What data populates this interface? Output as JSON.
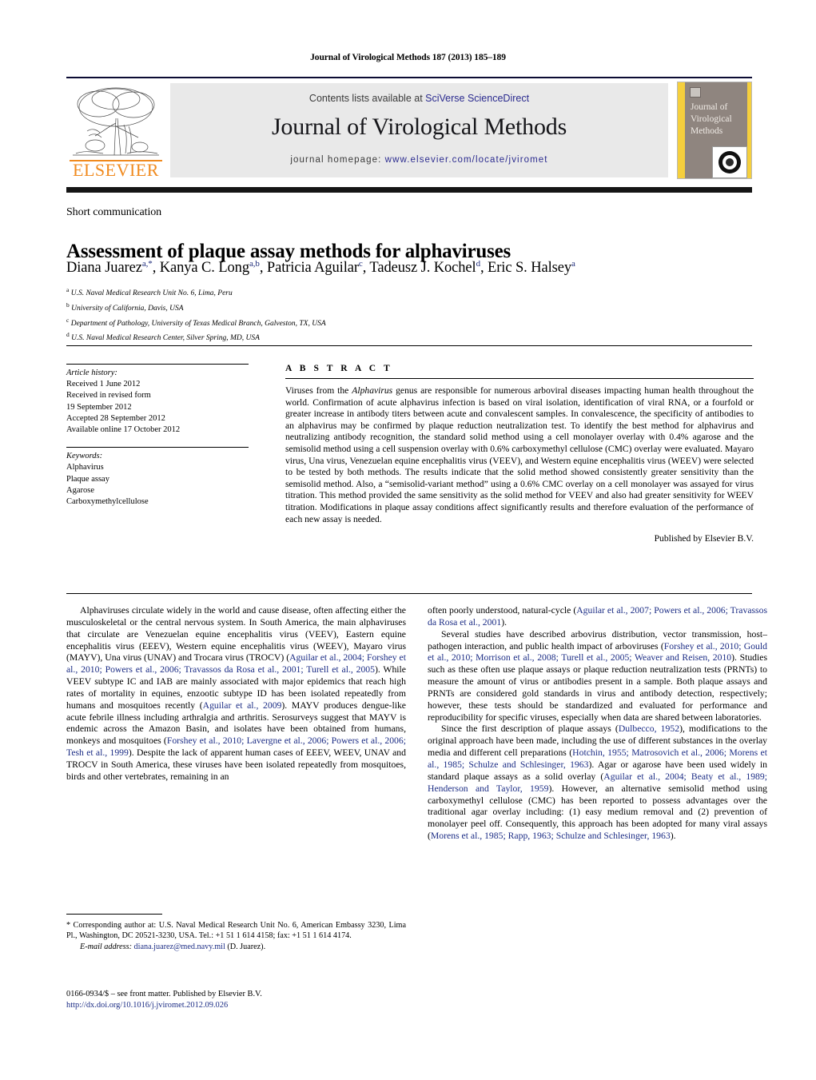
{
  "running_head": "Journal of Virological Methods 187 (2013) 185–189",
  "masthead": {
    "contents_prefix": "Contents lists available at ",
    "contents_link": "SciVerse ScienceDirect",
    "journal_title": "Journal of Virological Methods",
    "homepage_prefix": "journal homepage: ",
    "homepage_url": "www.elsevier.com/locate/jviromet",
    "publisher_logo_text": "ELSEVIER",
    "cover_title": "Journal of Virological Methods",
    "link_color": "#2b2b8f",
    "band_color": "#e9e9e9",
    "cover_accent": "#f5cf3d",
    "logo_color": "#f08a1e"
  },
  "article": {
    "section_type": "Short communication",
    "title": "Assessment of plaque assay methods for alphaviruses",
    "authors_html": "Diana Juarez<sup>a,*</sup>, Kanya C. Long<sup>a,b</sup>, Patricia Aguilar<sup>c</sup>, Tadeusz J. Kochel<sup>d</sup>, Eric S. Halsey<sup>a</sup>",
    "affiliations": [
      {
        "marker": "a",
        "text": "U.S. Naval Medical Research Unit No. 6, Lima, Peru"
      },
      {
        "marker": "b",
        "text": "University of California, Davis, USA"
      },
      {
        "marker": "c",
        "text": "Department of Pathology, University of Texas Medical Branch, Galveston, TX, USA"
      },
      {
        "marker": "d",
        "text": "U.S. Naval Medical Research Center, Silver Spring, MD, USA"
      }
    ]
  },
  "article_info": {
    "history_label": "Article history:",
    "history_lines": [
      "Received 1 June 2012",
      "Received in revised form",
      "19 September 2012",
      "Accepted 28 September 2012",
      "Available online 17 October 2012"
    ],
    "keywords_label": "Keywords:",
    "keywords": [
      "Alphavirus",
      "Plaque assay",
      "Agarose",
      "Carboxymethylcellulose"
    ]
  },
  "abstract": {
    "label": "A B S T R A C T",
    "text": "Viruses from the Alphavirus genus are responsible for numerous arboviral diseases impacting human health throughout the world. Confirmation of acute alphavirus infection is based on viral isolation, identification of viral RNA, or a fourfold or greater increase in antibody titers between acute and convalescent samples. In convalescence, the specificity of antibodies to an alphavirus may be confirmed by plaque reduction neutralization test. To identify the best method for alphavirus and neutralizing antibody recognition, the standard solid method using a cell monolayer overlay with 0.4% agarose and the semisolid method using a cell suspension overlay with 0.6% carboxymethyl cellulose (CMC) overlay were evaluated. Mayaro virus, Una virus, Venezuelan equine encephalitis virus (VEEV), and Western equine encephalitis virus (WEEV) were selected to be tested by both methods. The results indicate that the solid method showed consistently greater sensitivity than the semisolid method. Also, a “semisolid-variant method” using a 0.6% CMC overlay on a cell monolayer was assayed for virus titration. This method provided the same sensitivity as the solid method for VEEV and also had greater sensitivity for WEEV titration. Modifications in plaque assay conditions affect significantly results and therefore evaluation of the performance of each new assay is needed.",
    "italic_term": "Alphavirus",
    "published_by": "Published by Elsevier B.V."
  },
  "body": {
    "left_column": [
      "Alphaviruses circulate widely in the world and cause disease, often affecting either the musculoskeletal or the central nervous system. In South America, the main alphaviruses that circulate are Venezuelan equine encephalitis virus (VEEV), Eastern equine encephalitis virus (EEEV), Western equine encephalitis virus (WEEV), Mayaro virus (MAYV), Una virus (UNAV) and Trocara virus (TROCV) (Aguilar et al., 2004; Forshey et al., 2010; Powers et al., 2006; Travassos da Rosa et al., 2001; Turell et al., 2005). While VEEV subtype IC and IAB are mainly associated with major epidemics that reach high rates of mortality in equines, enzootic subtype ID has been isolated repeatedly from humans and mosquitoes recently (Aguilar et al., 2009). MAYV produces dengue-like acute febrile illness including arthralgia and arthritis. Serosurveys suggest that MAYV is endemic across the Amazon Basin, and isolates have been obtained from humans, monkeys and mosquitoes (Forshey et al., 2010; Lavergne et al., 2006; Powers et al., 2006; Tesh et al., 1999). Despite the lack of apparent human cases of EEEV, WEEV, UNAV and TROCV in South America, these viruses have been isolated repeatedly from mosquitoes, birds and other vertebrates, remaining in an"
    ],
    "right_column": [
      "often poorly understood, natural-cycle (Aguilar et al., 2007; Powers et al., 2006; Travassos da Rosa et al., 2001).",
      "Several studies have described arbovirus distribution, vector transmission, host–pathogen interaction, and public health impact of arboviruses (Forshey et al., 2010; Gould et al., 2010; Morrison et al., 2008; Turell et al., 2005; Weaver and Reisen, 2010). Studies such as these often use plaque assays or plaque reduction neutralization tests (PRNTs) to measure the amount of virus or antibodies present in a sample. Both plaque assays and PRNTs are considered gold standards in virus and antibody detection, respectively; however, these tests should be standardized and evaluated for performance and reproducibility for specific viruses, especially when data are shared between laboratories.",
      "Since the first description of plaque assays (Dulbecco, 1952), modifications to the original approach have been made, including the use of different substances in the overlay media and different cell preparations (Hotchin, 1955; Matrosovich et al., 2006; Morens et al., 1985; Schulze and Schlesinger, 1963). Agar or agarose have been used widely in standard plaque assays as a solid overlay (Aguilar et al., 2004; Beaty et al., 1989; Henderson and Taylor, 1959). However, an alternative semisolid method using carboxymethyl cellulose (CMC) has been reported to possess advantages over the traditional agar overlay including: (1) easy medium removal and (2) prevention of monolayer peel off. Consequently, this approach has been adopted for many viral assays (Morens et al., 1985; Rapp, 1963; Schulze and Schlesinger, 1963)."
    ],
    "reference_color": "#1c2d85"
  },
  "footnote": {
    "corresponding": "* Corresponding author at: U.S. Naval Medical Research Unit No. 6, American Embassy 3230, Lima Pl., Washington, DC 20521-3230, USA. Tel.: +1 51 1 614 4158; fax: +1 51 1 614 4174.",
    "email_label": "E-mail address:",
    "email": "diana.juarez@med.navy.mil",
    "email_suffix": "(D. Juarez)."
  },
  "footer": {
    "copyright": "0166-0934/$ – see front matter. Published by Elsevier B.V.",
    "doi": "http://dx.doi.org/10.1016/j.jviromet.2012.09.026"
  }
}
